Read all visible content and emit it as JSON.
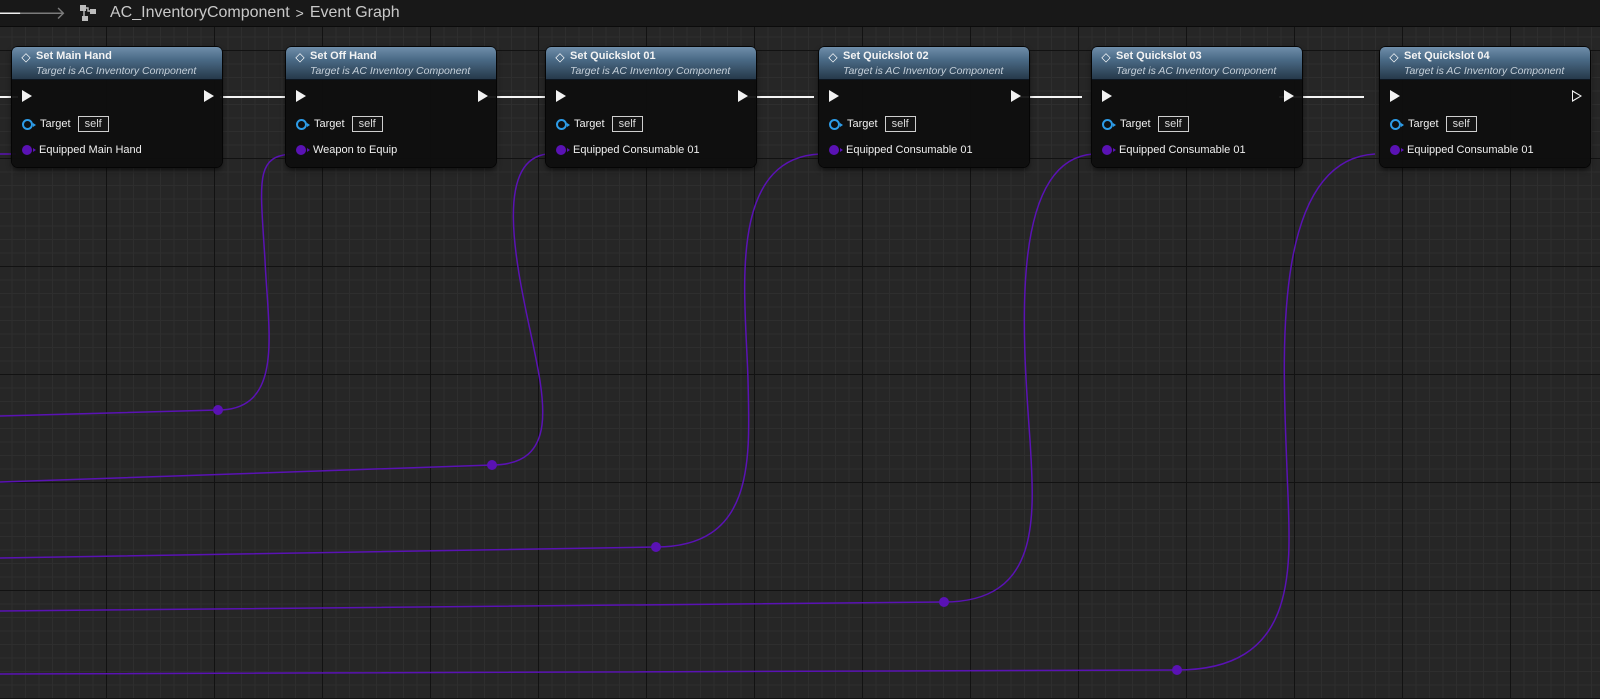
{
  "breadcrumb": {
    "blueprint": "AC_InventoryComponent",
    "separator": ">",
    "graph": "Event Graph"
  },
  "icons": {
    "back": "arrow-left-icon",
    "forward": "arrow-right-icon",
    "graph": "graph-icon",
    "function": "function-icon"
  },
  "colors": {
    "exec_wire": "#ffffff",
    "struct_wire": "#5a12b4",
    "object_pin": "#2d9ce8",
    "node_header": "#4b6b87"
  },
  "nodes": [
    {
      "title": "Set Main Hand",
      "subtitle": "Target is AC Inventory Component",
      "target_label": "Target",
      "target_value": "self",
      "param_label": "Equipped Main Hand"
    },
    {
      "title": "Set Off Hand",
      "subtitle": "Target is AC Inventory Component",
      "target_label": "Target",
      "target_value": "self",
      "param_label": "Weapon to Equip"
    },
    {
      "title": "Set Quickslot 01",
      "subtitle": "Target is AC Inventory Component",
      "target_label": "Target",
      "target_value": "self",
      "param_label": "Equipped Consumable 01"
    },
    {
      "title": "Set Quickslot 02",
      "subtitle": "Target is AC Inventory Component",
      "target_label": "Target",
      "target_value": "self",
      "param_label": "Equipped Consumable 01"
    },
    {
      "title": "Set Quickslot 03",
      "subtitle": "Target is AC Inventory Component",
      "target_label": "Target",
      "target_value": "self",
      "param_label": "Equipped Consumable 01"
    },
    {
      "title": "Set Quickslot 04",
      "subtitle": "Target is AC Inventory Component",
      "target_label": "Target",
      "target_value": "self",
      "param_label": "Equipped Consumable 01"
    }
  ]
}
